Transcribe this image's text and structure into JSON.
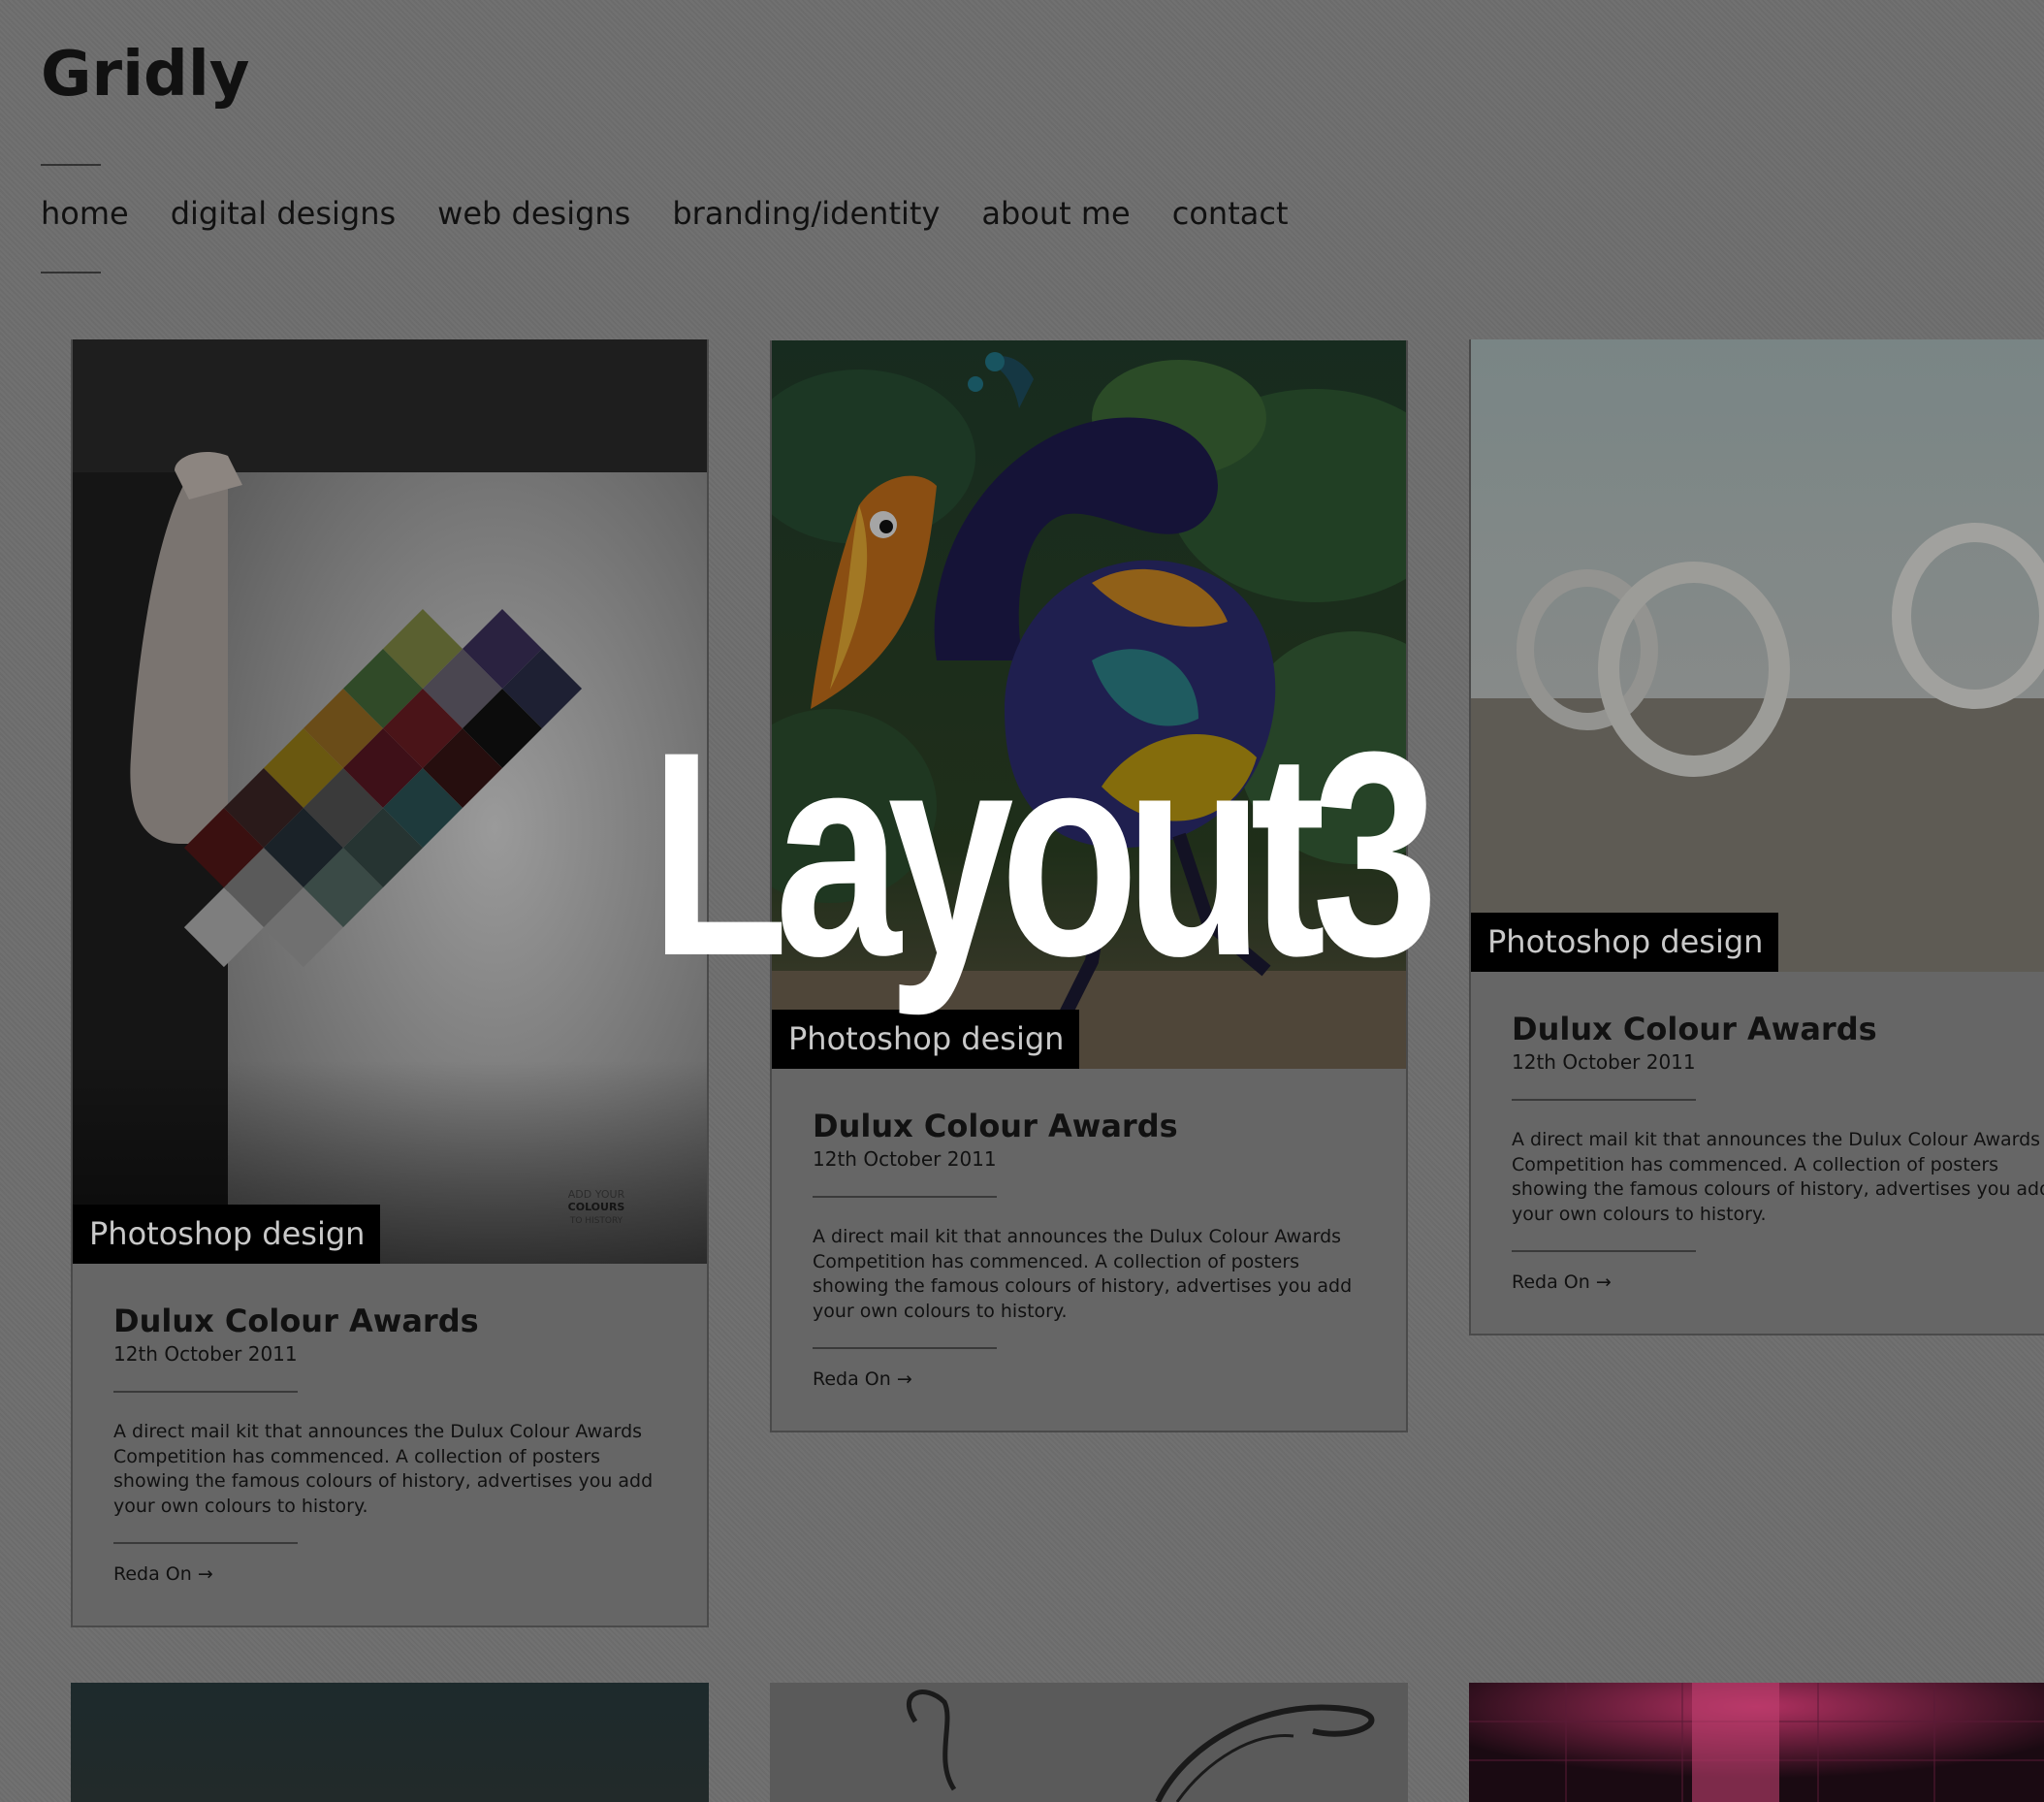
{
  "site": {
    "logo": "Gridly"
  },
  "nav": {
    "items": [
      {
        "label": "home"
      },
      {
        "label": "digital designs"
      },
      {
        "label": "web designs"
      },
      {
        "label": "branding/identity"
      },
      {
        "label": "about me"
      },
      {
        "label": "contact"
      }
    ]
  },
  "overlay": {
    "label": "Layout3"
  },
  "posts": [
    {
      "tag": "Photoshop design",
      "title": "Dulux Colour Awards",
      "date": "12th October 2011",
      "excerpt": "A direct mail kit that announces the Dulux Colour Awards Competition has commenced. A collection of posters showing the famous colours of history, advertises you add your own colours to history.",
      "read_more": "Reda On →",
      "image": "poster-held-by-hand",
      "poster_text": "ADD YOUR COLOURS TO HISTORY"
    },
    {
      "tag": "Photoshop design",
      "title": "Dulux Colour Awards",
      "date": "12th October 2011",
      "excerpt": "A direct mail kit that announces the Dulux Colour Awards Competition has commenced. A collection of posters showing the famous colours of history, advertises you add your own colours to history.",
      "read_more": "Reda On →",
      "image": "colorful-bird-in-jungle"
    },
    {
      "tag": "Photoshop design",
      "title": "Dulux Colour Awards",
      "date": "12th October 2011",
      "excerpt": "A direct mail kit that announces the Dulux Colour Awards Competition has commenced. A collection of posters showing the famous colours of history, advertises you add your own colours to history.",
      "read_more": "Reda On →",
      "image": "white-rings-in-desert"
    }
  ],
  "next_row": [
    {
      "image": "dark-teal-gradient"
    },
    {
      "image": "calligraphy-letter"
    },
    {
      "image": "pink-neon-grid"
    }
  ],
  "colors": {
    "background": "#6e6e6e",
    "card_background": "#666666",
    "tag_background": "#000000",
    "tag_text": "#c9c9c9",
    "overlay_text": "#ffffff"
  }
}
